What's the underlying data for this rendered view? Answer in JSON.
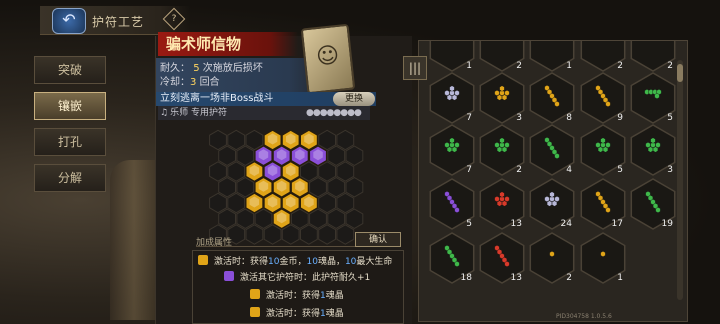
{
  "header": {
    "title": "护符工艺",
    "title_icon": "?"
  },
  "back_button": {
    "icon": "back-arrow-icon"
  },
  "side_tabs": [
    {
      "label": "突破",
      "active": false
    },
    {
      "label": "镶嵌",
      "active": true
    },
    {
      "label": "打孔",
      "active": false
    },
    {
      "label": "分解",
      "active": false
    }
  ],
  "item": {
    "name": "骗术师信物",
    "durability_label": "耐久：",
    "durability_value": "5",
    "durability_suffix": "次施放后损坏",
    "cooldown_label": "冷却：",
    "cooldown_value": "3",
    "cooldown_suffix": "回合",
    "effect": "立刻逃离一场非Boss战斗",
    "replace_label": "更换",
    "class_label": "乐师 专用护符",
    "class_dots": "●●●●●●●●"
  },
  "board": {
    "colors": {
      "purple": "#8a4fd8",
      "gold": "#e0a418",
      "empty": "#1c1a18"
    }
  },
  "attributes": {
    "title": "加成属性",
    "confirm_label": "确认",
    "lines": [
      {
        "icon_color": "#e0a418",
        "prefix": "激活时：获得",
        "v1": "10",
        "t1": "金币，",
        "v2": "10",
        "t2": "魂晶，",
        "v3": "10",
        "t3": "最大生命"
      },
      {
        "icon_color": "#8a4fd8",
        "text": "激活其它护符时：此护符耐久+1"
      },
      {
        "icon_color": "#e0a418",
        "prefix": "激活时：获得",
        "v1": "1",
        "t1": "魂晶"
      },
      {
        "icon_color": "#e0a418",
        "prefix": "激活时：获得",
        "v1": "1",
        "t1": "魂晶"
      }
    ]
  },
  "inventory": {
    "filter_icon": "filter-icon",
    "rows": [
      [
        {
          "count": "1",
          "color": "#3fb84a",
          "shape": "dots"
        },
        {
          "count": "2",
          "color": "#3fb84a",
          "shape": "dots"
        },
        {
          "count": "1",
          "color": "#3fb84a",
          "shape": "dots"
        },
        {
          "count": "2",
          "color": "#3fb84a",
          "shape": "dots"
        },
        {
          "count": "2",
          "color": "#d83a2a",
          "shape": "dots"
        }
      ],
      [
        {
          "count": "7",
          "color": "#b8b8d8",
          "shape": "tri"
        },
        {
          "count": "3",
          "color": "#e0a418",
          "shape": "tri"
        },
        {
          "count": "8",
          "color": "#e0a418",
          "shape": "diag"
        },
        {
          "count": "9",
          "color": "#e0a418",
          "shape": "diag"
        },
        {
          "count": "5",
          "color": "#3fb84a",
          "shape": "line"
        }
      ],
      [
        {
          "count": "7",
          "color": "#3fb84a",
          "shape": "tri"
        },
        {
          "count": "2",
          "color": "#3fb84a",
          "shape": "tri"
        },
        {
          "count": "4",
          "color": "#3fb84a",
          "shape": "diag"
        },
        {
          "count": "5",
          "color": "#3fb84a",
          "shape": "tri"
        },
        {
          "count": "3",
          "color": "#3fb84a",
          "shape": "tri"
        }
      ],
      [
        {
          "count": "5",
          "color": "#8a4fd8",
          "shape": "diag"
        },
        {
          "count": "13",
          "color": "#d83a2a",
          "shape": "tri"
        },
        {
          "count": "24",
          "color": "#b8b8d8",
          "shape": "tri"
        },
        {
          "count": "17",
          "color": "#e0a418",
          "shape": "diag"
        },
        {
          "count": "19",
          "color": "#3fb84a",
          "shape": "diag"
        }
      ],
      [
        {
          "count": "18",
          "color": "#3fb84a",
          "shape": "diag"
        },
        {
          "count": "13",
          "color": "#d83a2a",
          "shape": "diag"
        },
        {
          "count": "2",
          "color": "#e0a418",
          "shape": "single"
        },
        {
          "count": "1",
          "color": "#e0a418",
          "shape": "single"
        }
      ]
    ]
  },
  "version_text": "PID304758  1.0.5.6"
}
